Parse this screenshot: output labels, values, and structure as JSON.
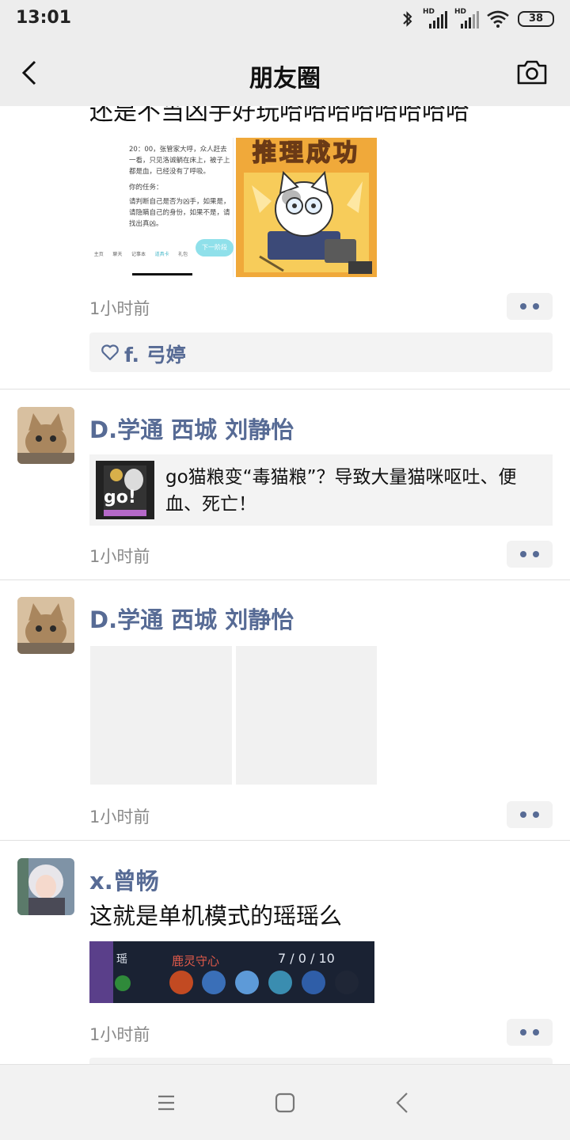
{
  "status": {
    "time": "13:01",
    "signal1_label": "HD",
    "signal2_label": "HD",
    "battery": "38"
  },
  "header": {
    "title": "朋友圈"
  },
  "posts": [
    {
      "text_partial": "还是不当凶手好玩哈哈哈哈哈哈哈哈",
      "time": "1小时前",
      "likes": "f. 弓婷",
      "image1_text": "20：00，张管家大呼，众人赶去一看，只见洛诚躺在床上，被子上都是血，已经没有了呼吸。",
      "image1_task_label": "你的任务：",
      "image1_task": "请判断自己是否为凶手，如果是，请隐瞒自己的身份，如果不是，请找出真凶。",
      "image1_tabs": [
        "主页",
        "聊天",
        "记事本",
        "道具卡",
        "礼包"
      ],
      "image1_button": "下一阶段",
      "image2_banner": "推理成功"
    },
    {
      "author": "D.学通 西城 刘静怡",
      "link_title": "go猫粮变“毒猫粮”？导致大量猫咪呕吐、便血、死亡！",
      "link_thumb_text": "go!",
      "time": "1小时前"
    },
    {
      "author": "D.学通 西城 刘静怡",
      "time": "1小时前"
    },
    {
      "author": "x.曾畅",
      "text": "这就是单机模式的瑶瑶么",
      "game_hero": "瑶",
      "game_skill": "鹿灵守心",
      "game_score": "7 / 0 / 10",
      "time": "1小时前"
    }
  ],
  "colors": {
    "name": "#576b95",
    "bar": "#ededed"
  }
}
